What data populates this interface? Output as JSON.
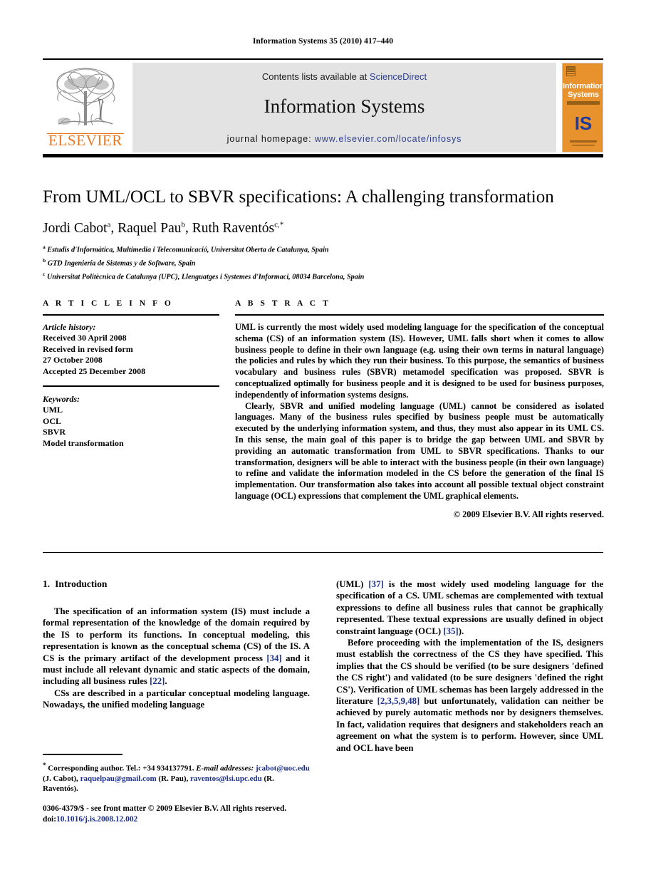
{
  "running_head": "Information Systems 35 (2010) 417–440",
  "masthead": {
    "publisher_logo_name": "elsevier-tree-logo",
    "publisher_wordmark": "ELSEVIER",
    "contents_prefix": "Contents lists available at ",
    "contents_link": "ScienceDirect",
    "journal_title": "Information Systems",
    "homepage_prefix": "journal homepage: ",
    "homepage_url": "www.elsevier.com/locate/infosys",
    "cover": {
      "title_line1": "Information",
      "title_line2": "Systems",
      "logo_text": "IS"
    },
    "colors": {
      "elsevier_orange": "#E87722",
      "link_blue": "#2C3E8F",
      "banner_gray": "#E3E3E3",
      "cover_orange": "#E8922E",
      "cover_logo_blue": "#1F3C9B"
    }
  },
  "article": {
    "title": "From UML/OCL to SBVR specifications: A challenging transformation",
    "authors": [
      {
        "name": "Jordi Cabot",
        "marks": "a"
      },
      {
        "name": "Raquel Pau",
        "marks": "b"
      },
      {
        "name": "Ruth Raventós",
        "marks": "c,*"
      }
    ],
    "authors_separator": ", ",
    "affiliations": [
      {
        "mark": "a",
        "text": "Estudis d'Informàtica, Multimedia i Telecomunicació, Universitat Oberta de Catalunya, Spain"
      },
      {
        "mark": "b",
        "text": "GTD Ingeniería de Sistemas y de Software, Spain"
      },
      {
        "mark": "c",
        "text": "Universitat Politècnica de Catalunya (UPC), Llenguatges i Systemes d'Informaci, 08034 Barcelona, Spain"
      }
    ]
  },
  "article_info": {
    "heading": "A R T I C L E   I N F O",
    "history_label": "Article history:",
    "history": [
      "Received 30 April 2008",
      "Received in revised form",
      "27 October 2008",
      "Accepted 25 December 2008"
    ],
    "keywords_label": "Keywords:",
    "keywords": [
      "UML",
      "OCL",
      "SBVR",
      "Model transformation"
    ]
  },
  "abstract": {
    "heading": "A B S T R A C T",
    "paragraph_1": "UML is currently the most widely used modeling language for the specification of the conceptual schema (CS) of an information system (IS). However, UML falls short when it comes to allow business people to define in their own language (e.g. using their own terms in natural language) the policies and rules by which they run their business. To this purpose, the semantics of business vocabulary and business rules (SBVR) metamodel specification was proposed. SBVR is conceptualized optimally for business people and it is designed to be used for business purposes, independently of information systems designs.",
    "paragraph_2": "Clearly, SBVR and unified modeling language (UML) cannot be considered as isolated languages. Many of the business rules specified by business people must be automatically executed by the underlying information system, and thus, they must also appear in its UML CS. In this sense, the main goal of this paper is to bridge the gap between UML and SBVR by providing an automatic transformation from UML to SBVR specifications. Thanks to our transformation, designers will be able to interact with the business people (in their own language) to refine and validate the information modeled in the CS before the generation of the final IS implementation. Our transformation also takes into account all possible textual object constraint language (OCL) expressions that complement the UML graphical elements.",
    "copyright": "© 2009 Elsevier B.V. All rights reserved."
  },
  "body": {
    "section_number": "1.",
    "section_title": "Introduction",
    "left_paragraph_1_a": "The specification of an information system (IS) must include a formal representation of the knowledge of the domain required by the IS to perform its functions. In conceptual modeling, this representation is known as the conceptual schema (CS) of the IS. A CS is the primary artifact of the development process ",
    "left_paragraph_1_cite_1": "[34]",
    "left_paragraph_1_b": " and it must include all relevant dynamic and static aspects of the domain, including all business rules ",
    "left_paragraph_1_cite_2": "[22]",
    "left_paragraph_1_c": ".",
    "left_paragraph_2": "CSs are described in a particular conceptual modeling language. Nowadays, the unified modeling language",
    "right_paragraph_1_a": "(UML) ",
    "right_paragraph_1_cite_1": "[37]",
    "right_paragraph_1_b": " is the most widely used modeling language for the specification of a CS. UML schemas are complemented with textual expressions to define all business rules that cannot be graphically represented. These textual expressions are usually defined in object constraint language (OCL) ",
    "right_paragraph_1_cite_2": "[35]",
    "right_paragraph_1_c": ").",
    "right_paragraph_2_a": "Before proceeding with the implementation of the IS, designers must establish the correctness of the CS they have specified. This implies that the CS should be verified (to be sure designers 'defined the CS right') and validated (to be sure designers 'defined the right CS'). Verification of UML schemas has been largely addressed in the literature ",
    "right_paragraph_2_cite_1": "[2,3,5,9,48]",
    "right_paragraph_2_b": " but unfortunately, validation can neither be achieved by purely automatic methods nor by designers themselves. In fact, validation requires that designers and stakeholders reach an agreement on what the system is to perform. However, since UML and OCL have been"
  },
  "footnote": {
    "star": "*",
    "corresponding": " Corresponding author. Tel.: +34 934137791.",
    "email_label": "E-mail addresses:",
    "email_1": "jcabot@uoc.edu",
    "email_1_owner": " (J. Cabot), ",
    "email_2": "raquelpau@gmail.com",
    "email_2_owner": " (R. Pau), ",
    "email_3": "raventos@lsi.upc.edu",
    "email_3_owner": " (R. Raventós)."
  },
  "imprint": {
    "front_matter": "0306-4379/$ - see front matter © 2009 Elsevier B.V. All rights reserved.",
    "doi_label": "doi:",
    "doi_value": "10.1016/j.is.2008.12.002"
  }
}
